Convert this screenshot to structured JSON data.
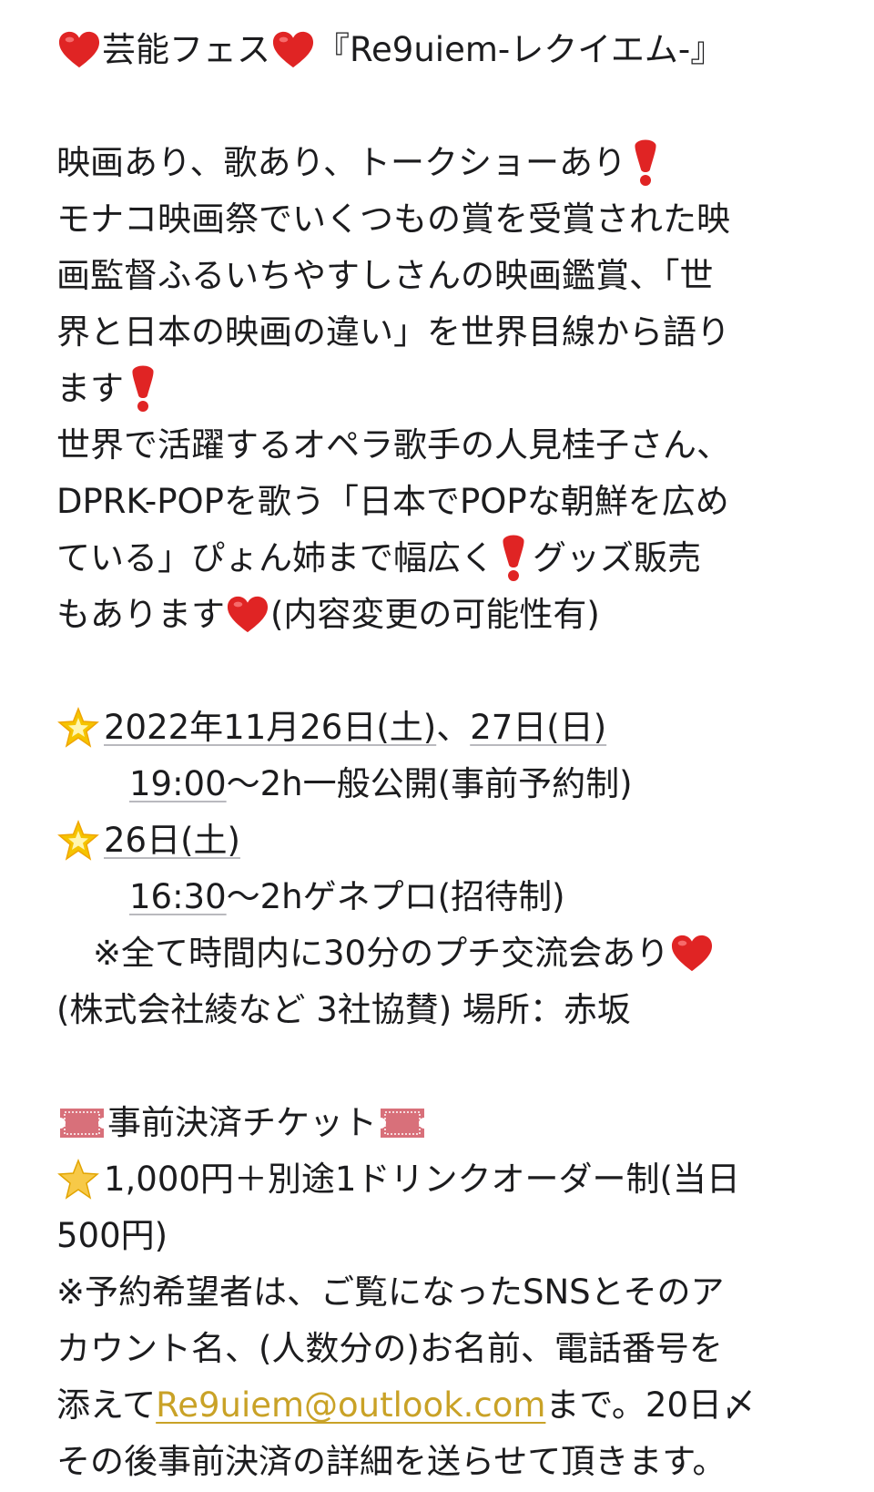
{
  "post": {
    "title": "芸能フェス",
    "title_sub": "『Re9uiem-レクイエム-』",
    "p1_l1": "映画あり、歌あり、トークショーあり",
    "p1_l2": "モナコ映画祭でいくつもの賞を受賞された映",
    "p1_l3": "画監督ふるいちやすしさんの映画鑑賞、「世",
    "p1_l4": "界と日本の映画の違い」を世界目線から語り",
    "p1_l5": "ます",
    "p1_l6": "世界で活躍するオペラ歌手の人見桂子さん、",
    "p1_l7": "DPRK-POPを歌う「日本でPOPな朝鮮を広め",
    "p1_l8a": "ている」ぴょん姉まで幅広く",
    "p1_l8b": "グッズ販売",
    "p1_l9a": "もあります",
    "p1_l9b": "(内容変更の可能性有)",
    "date1_a": "2022年11月26日(土)",
    "date1_sep": "、",
    "date1_b": "27日(日)",
    "time1": "19:00",
    "time1_rest": "〜2h一般公開(事前予約制)",
    "date2": "26日(土)",
    "time2": "16:30",
    "time2_rest": "〜2hゲネプロ(招待制)",
    "note": "※全て時間内に30分のプチ交流会あり",
    "sponsor": "(株式会社綾など 3社協賛) 場所：赤坂",
    "ticket_heading": "事前決済チケット",
    "ticket_icon_text": "ADMIT ONE",
    "price_l1": "1,000円＋別途1ドリンクオーダー制(当日",
    "price_l2": "500円)",
    "res_l1": "※予約希望者は、ご覧になったSNSとそのア",
    "res_l2": "カウント名、(人数分の)お名前、電話番号を",
    "res_l3a": "添えて",
    "email": "Re9uiem@outlook.com",
    "res_l3b": "まで。20日〆",
    "res_l4": "その後事前決済の詳細を送らせて頂きます。"
  },
  "icons": {
    "heart": "heart-icon",
    "exclamation": "red-exclamation-icon",
    "glowing_star": "glowing-star-icon",
    "star": "star-icon",
    "ticket": "admission-ticket-icon"
  },
  "colors": {
    "heart": "#e02424",
    "link": "#c9a227",
    "star": "#f5c400",
    "ticket": "#d8707a"
  }
}
